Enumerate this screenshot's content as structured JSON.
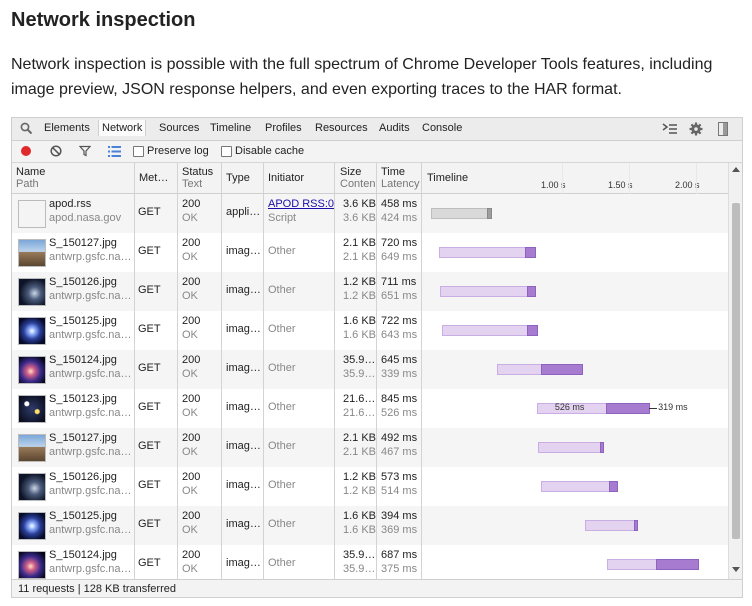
{
  "article": {
    "title": "Network inspection",
    "intro": "Network inspection is possible with the full spectrum of Chrome Developer Tools features, including image preview, JSON response helpers, and even exporting traces to the HAR format."
  },
  "devtools": {
    "tabs": [
      "Elements",
      "Network",
      "Sources",
      "Timeline",
      "Profiles",
      "Resources",
      "Audits",
      "Console"
    ],
    "active_tab": "Network",
    "toolbar": {
      "preserve_log": "Preserve log",
      "disable_cache": "Disable cache"
    },
    "columns": {
      "name": "Name",
      "path": "Path",
      "method": "Met…",
      "status": "Status",
      "status_text": "Text",
      "type": "Type",
      "initiator": "Initiator",
      "size": "Size",
      "content": "Conten",
      "time": "Time",
      "latency": "Latency",
      "timeline": "Timeline"
    },
    "ticks": [
      "1.00 s",
      "1.50 s",
      "2.00 s"
    ],
    "rows": [
      {
        "name": "apod.rss",
        "path": "apod.nasa.gov",
        "method": "GET",
        "status": "200",
        "status_text": "OK",
        "type": "appli…",
        "initiator": "APOD RSS:0",
        "initiator2": "Script",
        "size": "3.6 KB",
        "content": "3.6 KB",
        "time": "458 ms",
        "latency": "424 ms",
        "thumb": "doc",
        "bar_start": 0.0,
        "bar_wait_end": 0.424,
        "bar_end": 0.458
      },
      {
        "name": "S_150127.jpg",
        "path": "antwrp.gsfc.na…",
        "method": "GET",
        "status": "200",
        "status_text": "OK",
        "type": "imag…",
        "initiator": "Other",
        "initiator2": "",
        "size": "2.1 KB",
        "content": "2.1 KB",
        "time": "720 ms",
        "latency": "649 ms",
        "thumb": "landscape",
        "bar_start": 0.06,
        "bar_wait_end": 0.709,
        "bar_end": 0.78
      },
      {
        "name": "S_150126.jpg",
        "path": "antwrp.gsfc.na…",
        "method": "GET",
        "status": "200",
        "status_text": "OK",
        "type": "imag…",
        "initiator": "Other",
        "initiator2": "",
        "size": "1.2 KB",
        "content": "1.2 KB",
        "time": "711 ms",
        "latency": "651 ms",
        "thumb": "dark",
        "bar_start": 0.07,
        "bar_wait_end": 0.721,
        "bar_end": 0.781
      },
      {
        "name": "S_150125.jpg",
        "path": "antwrp.gsfc.na…",
        "method": "GET",
        "status": "200",
        "status_text": "OK",
        "type": "imag…",
        "initiator": "Other",
        "initiator2": "",
        "size": "1.6 KB",
        "content": "1.6 KB",
        "time": "722 ms",
        "latency": "643 ms",
        "thumb": "galaxy",
        "bar_start": 0.08,
        "bar_wait_end": 0.723,
        "bar_end": 0.802
      },
      {
        "name": "S_150124.jpg",
        "path": "antwrp.gsfc.na…",
        "method": "GET",
        "status": "200",
        "status_text": "OK",
        "type": "imag…",
        "initiator": "Other",
        "initiator2": "",
        "size": "35.9…",
        "content": "35.9…",
        "time": "645 ms",
        "latency": "339 ms",
        "thumb": "nebula",
        "bar_start": 0.49,
        "bar_wait_end": 0.829,
        "bar_end": 1.135
      },
      {
        "name": "S_150123.jpg",
        "path": "antwrp.gsfc.na…",
        "method": "GET",
        "status": "200",
        "status_text": "OK",
        "type": "imag…",
        "initiator": "Other",
        "initiator2": "",
        "size": "21.6…",
        "content": "21.6…",
        "time": "845 ms",
        "latency": "526 ms",
        "thumb": "stars",
        "bar_start": 0.79,
        "bar_wait_end": 1.316,
        "bar_end": 1.635,
        "wait_label": "526 ms",
        "recv_label": "319 ms"
      },
      {
        "name": "S_150127.jpg",
        "path": "antwrp.gsfc.na…",
        "method": "GET",
        "status": "200",
        "status_text": "OK",
        "type": "imag…",
        "initiator": "Other",
        "initiator2": "",
        "size": "2.1 KB",
        "content": "2.1 KB",
        "time": "492 ms",
        "latency": "467 ms",
        "thumb": "landscape",
        "bar_start": 0.8,
        "bar_wait_end": 1.267,
        "bar_end": 1.292
      },
      {
        "name": "S_150126.jpg",
        "path": "antwrp.gsfc.na…",
        "method": "GET",
        "status": "200",
        "status_text": "OK",
        "type": "imag…",
        "initiator": "Other",
        "initiator2": "",
        "size": "1.2 KB",
        "content": "1.2 KB",
        "time": "573 ms",
        "latency": "514 ms",
        "thumb": "dark",
        "bar_start": 0.82,
        "bar_wait_end": 1.334,
        "bar_end": 1.393
      },
      {
        "name": "S_150125.jpg",
        "path": "antwrp.gsfc.na…",
        "method": "GET",
        "status": "200",
        "status_text": "OK",
        "type": "imag…",
        "initiator": "Other",
        "initiator2": "",
        "size": "1.6 KB",
        "content": "1.6 KB",
        "time": "394 ms",
        "latency": "369 ms",
        "thumb": "galaxy",
        "bar_start": 1.15,
        "bar_wait_end": 1.519,
        "bar_end": 1.544
      },
      {
        "name": "S_150124.jpg",
        "path": "antwrp.gsfc.na…",
        "method": "GET",
        "status": "200",
        "status_text": "OK",
        "type": "imag…",
        "initiator": "Other",
        "initiator2": "",
        "size": "35.9…",
        "content": "35.9…",
        "time": "687 ms",
        "latency": "375 ms",
        "thumb": "nebula",
        "bar_start": 1.31,
        "bar_wait_end": 1.685,
        "bar_end": 1.997
      }
    ],
    "status_bar": "11 requests  |  128 KB transferred"
  }
}
